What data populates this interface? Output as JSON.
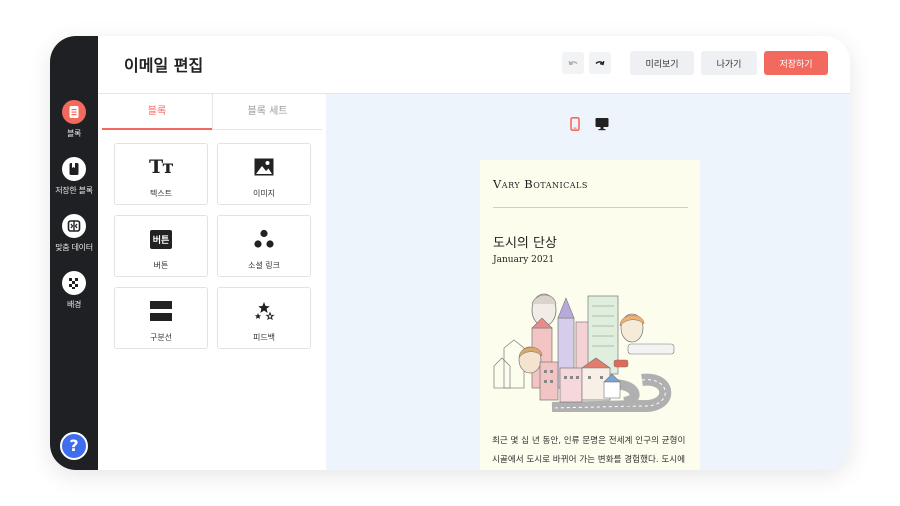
{
  "colors": {
    "accent": "#f26a5e",
    "rail": "#1f2023",
    "help": "#3f6df0",
    "canvas": "#eef4fc",
    "email_bg": "#fdfdee"
  },
  "rail": {
    "items": [
      {
        "label": "블록",
        "icon": "document-icon",
        "active": true
      },
      {
        "label": "저장한 블록",
        "icon": "saved-block-icon",
        "active": false
      },
      {
        "label": "맞춤 데이터",
        "icon": "custom-data-icon",
        "active": false
      },
      {
        "label": "배경",
        "icon": "pattern-icon",
        "active": false
      }
    ],
    "help_icon": "?"
  },
  "header": {
    "title": "이메일 편집",
    "undo_icon": "undo-icon",
    "redo_icon": "redo-icon",
    "preview_label": "미리보기",
    "exit_label": "나가기",
    "save_label": "저장하기"
  },
  "panel": {
    "tabs": [
      {
        "label": "블록",
        "active": true
      },
      {
        "label": "블록 세트",
        "active": false
      }
    ],
    "tiles": [
      {
        "label": "텍스트",
        "icon": "text-icon",
        "glyph": "Tт"
      },
      {
        "label": "이미지",
        "icon": "image-icon"
      },
      {
        "label": "버튼",
        "icon": "button-icon",
        "glyph": "버튼"
      },
      {
        "label": "소셜 링크",
        "icon": "social-links-icon"
      },
      {
        "label": "구분선",
        "icon": "divider-icon"
      },
      {
        "label": "피드백",
        "icon": "feedback-icon"
      }
    ]
  },
  "canvas": {
    "devices": [
      {
        "icon": "mobile-icon",
        "active": true
      },
      {
        "icon": "desktop-icon",
        "active": false
      }
    ],
    "email": {
      "brand": "Vary Botanicals",
      "headline": "도시의 단상",
      "date": "January 2021",
      "body_line_1": "최근 몇 십 년 동안, 인류 문명은 전세계 인구의 균형이",
      "body_line_2": "시골에서 도시로 바뀌어 가는 변화를 경험했다. 도시에"
    }
  }
}
